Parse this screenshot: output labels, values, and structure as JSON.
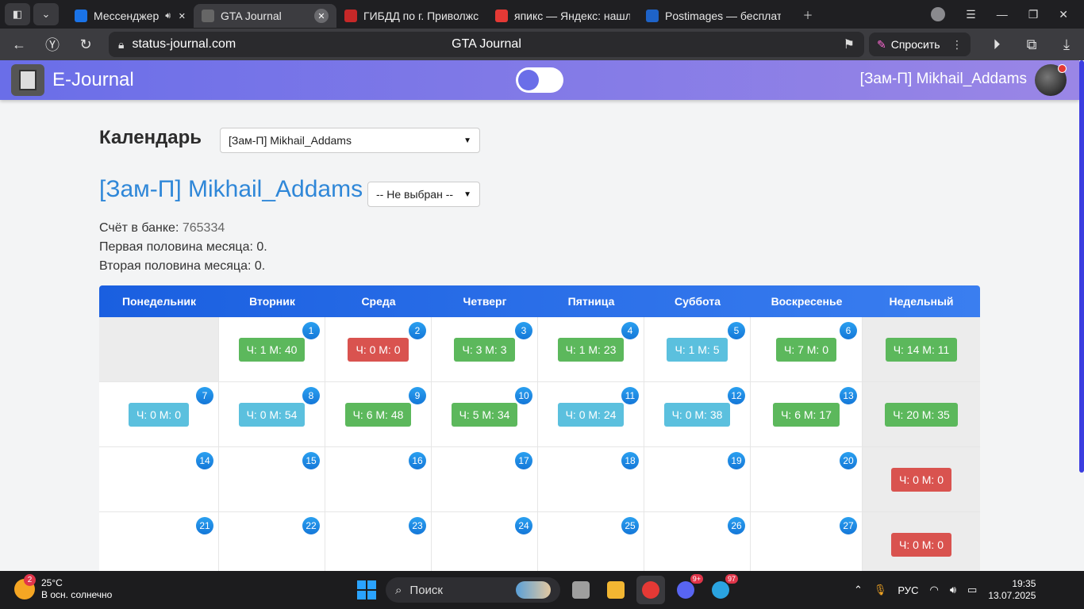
{
  "browser": {
    "tabs": [
      {
        "label": "Мессенджер",
        "favicon_color": "#1a73e8",
        "icon": "play-icon",
        "active": false,
        "sound": true
      },
      {
        "label": "GTA Journal",
        "favicon_color": "#666666",
        "icon": "journal-icon",
        "active": true,
        "sound": false
      },
      {
        "label": "ГИБДД по г. Приволжск",
        "favicon_color": "#c62828",
        "icon": "car-icon",
        "active": false,
        "sound": false
      },
      {
        "label": "япикс — Яндекс: нашлос",
        "favicon_color": "#e53935",
        "icon": "yandex-icon",
        "active": false,
        "sound": false
      },
      {
        "label": "Postimages — бесплатны",
        "favicon_color": "#1e63c8",
        "icon": "postimages-icon",
        "active": false,
        "sound": false
      }
    ],
    "url": "status-journal.com",
    "page_title": "GTA Journal",
    "ask_label": "Спросить"
  },
  "navbar": {
    "brand": "E-Journal",
    "user": "[Зам-П] Mikhail_Addams"
  },
  "calendar": {
    "title": "Календарь",
    "user_select": "[Зам-П] Mikhail_Addams",
    "user_name": "[Зам-П] Mikhail_Addams",
    "filter_select": "-- Не выбран --",
    "bank_label": "Счёт в банке:",
    "bank_value": "765334",
    "first_half": "Первая половина месяца: 0.",
    "second_half": "Вторая половина месяца: 0.",
    "headers": [
      "Понедельник",
      "Вторник",
      "Среда",
      "Четверг",
      "Пятница",
      "Суббота",
      "Воскресенье",
      "Недельный"
    ],
    "weeks": [
      {
        "days": [
          {
            "day": "",
            "text": "",
            "color": ""
          },
          {
            "day": "1",
            "text": "Ч: 1 М: 40",
            "color": "green"
          },
          {
            "day": "2",
            "text": "Ч: 0 М: 0",
            "color": "red"
          },
          {
            "day": "3",
            "text": "Ч: 3 М: 3",
            "color": "green"
          },
          {
            "day": "4",
            "text": "Ч: 1 М: 23",
            "color": "green"
          },
          {
            "day": "5",
            "text": "Ч: 1 М: 5",
            "color": "cyan"
          },
          {
            "day": "6",
            "text": "Ч: 7 М: 0",
            "color": "green"
          }
        ],
        "weekly": {
          "text": "Ч: 14 М: 11",
          "color": "green"
        }
      },
      {
        "days": [
          {
            "day": "7",
            "text": "Ч: 0 М: 0",
            "color": "cyan"
          },
          {
            "day": "8",
            "text": "Ч: 0 М: 54",
            "color": "cyan"
          },
          {
            "day": "9",
            "text": "Ч: 6 М: 48",
            "color": "green"
          },
          {
            "day": "10",
            "text": "Ч: 5 М: 34",
            "color": "green"
          },
          {
            "day": "11",
            "text": "Ч: 0 М: 24",
            "color": "cyan"
          },
          {
            "day": "12",
            "text": "Ч: 0 М: 38",
            "color": "cyan"
          },
          {
            "day": "13",
            "text": "Ч: 6 М: 17",
            "color": "green"
          }
        ],
        "weekly": {
          "text": "Ч: 20 М: 35",
          "color": "green"
        }
      },
      {
        "days": [
          {
            "day": "14",
            "text": "",
            "color": ""
          },
          {
            "day": "15",
            "text": "",
            "color": ""
          },
          {
            "day": "16",
            "text": "",
            "color": ""
          },
          {
            "day": "17",
            "text": "",
            "color": ""
          },
          {
            "day": "18",
            "text": "",
            "color": ""
          },
          {
            "day": "19",
            "text": "",
            "color": ""
          },
          {
            "day": "20",
            "text": "",
            "color": ""
          }
        ],
        "weekly": {
          "text": "Ч: 0 М: 0",
          "color": "red"
        }
      },
      {
        "days": [
          {
            "day": "21",
            "text": "",
            "color": ""
          },
          {
            "day": "22",
            "text": "",
            "color": ""
          },
          {
            "day": "23",
            "text": "",
            "color": ""
          },
          {
            "day": "24",
            "text": "",
            "color": ""
          },
          {
            "day": "25",
            "text": "",
            "color": ""
          },
          {
            "day": "26",
            "text": "",
            "color": ""
          },
          {
            "day": "27",
            "text": "",
            "color": ""
          }
        ],
        "weekly": {
          "text": "Ч: 0 М: 0",
          "color": "red"
        }
      }
    ]
  },
  "taskbar": {
    "weather_badge": "2",
    "temperature": "25°C",
    "weather_desc": "В осн. солнечно",
    "search_label": "Поиск",
    "apps": [
      {
        "name": "task-view",
        "color": "#9e9e9e",
        "badge": ""
      },
      {
        "name": "file-explorer",
        "color": "#f2b632",
        "badge": ""
      },
      {
        "name": "yandex-browser",
        "color": "#e53935",
        "badge": ""
      },
      {
        "name": "discord",
        "color": "#5865f2",
        "badge": "9+"
      },
      {
        "name": "telegram",
        "color": "#2aa3e0",
        "badge": "97"
      }
    ],
    "language": "РУС",
    "time": "19:35",
    "date": "13.07.2025"
  }
}
